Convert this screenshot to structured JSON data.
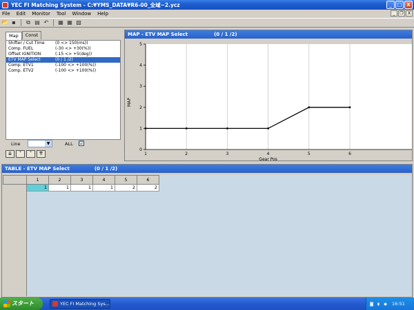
{
  "window": {
    "title": "YEC FI Matching System - C:¥YMS_DATA¥R6-00_全域~2.ycz",
    "min": "_",
    "max": "□",
    "close": "X"
  },
  "menu": [
    "File",
    "Edit",
    "Monitor",
    "Tool",
    "Window",
    "Help"
  ],
  "mdi": {
    "min": "_",
    "restore": "❐",
    "close": "X"
  },
  "toolbar": {
    "icons": [
      "open-icon",
      "save-icon",
      "copy-icon",
      "paste-icon",
      "undo-icon",
      "map-icon",
      "table-icon",
      "graph-icon"
    ]
  },
  "left": {
    "tabs": [
      "Map",
      "Const"
    ],
    "items": [
      {
        "name": "Shifter / Cut Time",
        "range": "(0 <> 150(ms))"
      },
      {
        "name": "Comp. FUEL",
        "range": "(-30 <> +30(%))"
      },
      {
        "name": "Offset IGNITION",
        "range": "(-15 <> +5(deg))"
      },
      {
        "name": "ETV MAP Select",
        "range": "(0 / 1 /2)"
      },
      {
        "name": "Comp. ETV1",
        "range": "(-100 <> +100(%))"
      },
      {
        "name": "Comp. ETV2",
        "range": "(-100 <> +100(%))"
      }
    ],
    "line_label": "Line",
    "all_label": "ALL",
    "all_checked": "☑"
  },
  "map": {
    "title": "MAP - ETV MAP Select",
    "index": "(0 / 1 /2)"
  },
  "table": {
    "title": "TABLE - ETV MAP Select",
    "index": "(0 / 1 /2)",
    "columns": [
      "1",
      "2",
      "3",
      "4",
      "5",
      "6"
    ],
    "values": [
      "1",
      "1",
      "1",
      "1",
      "2",
      "2"
    ]
  },
  "taskbar": {
    "start": "スタート",
    "task": "YEC FI Matching Sys...",
    "clock": "16:51"
  },
  "chart_data": {
    "type": "line",
    "x": [
      1,
      2,
      3,
      4,
      5,
      6
    ],
    "series": [
      {
        "values": [
          1,
          1,
          1,
          1,
          2,
          2
        ]
      }
    ],
    "xlabel": "Gear Pos",
    "ylabel": "MAP",
    "xlim": [
      1,
      6
    ],
    "ylim": [
      0,
      5
    ],
    "xticks": [
      "1",
      "2",
      "3",
      "4",
      "5",
      "6"
    ],
    "yticks": [
      "0",
      "1",
      "2",
      "3",
      "4",
      "5"
    ],
    "grid": true,
    "color": "#000000"
  }
}
